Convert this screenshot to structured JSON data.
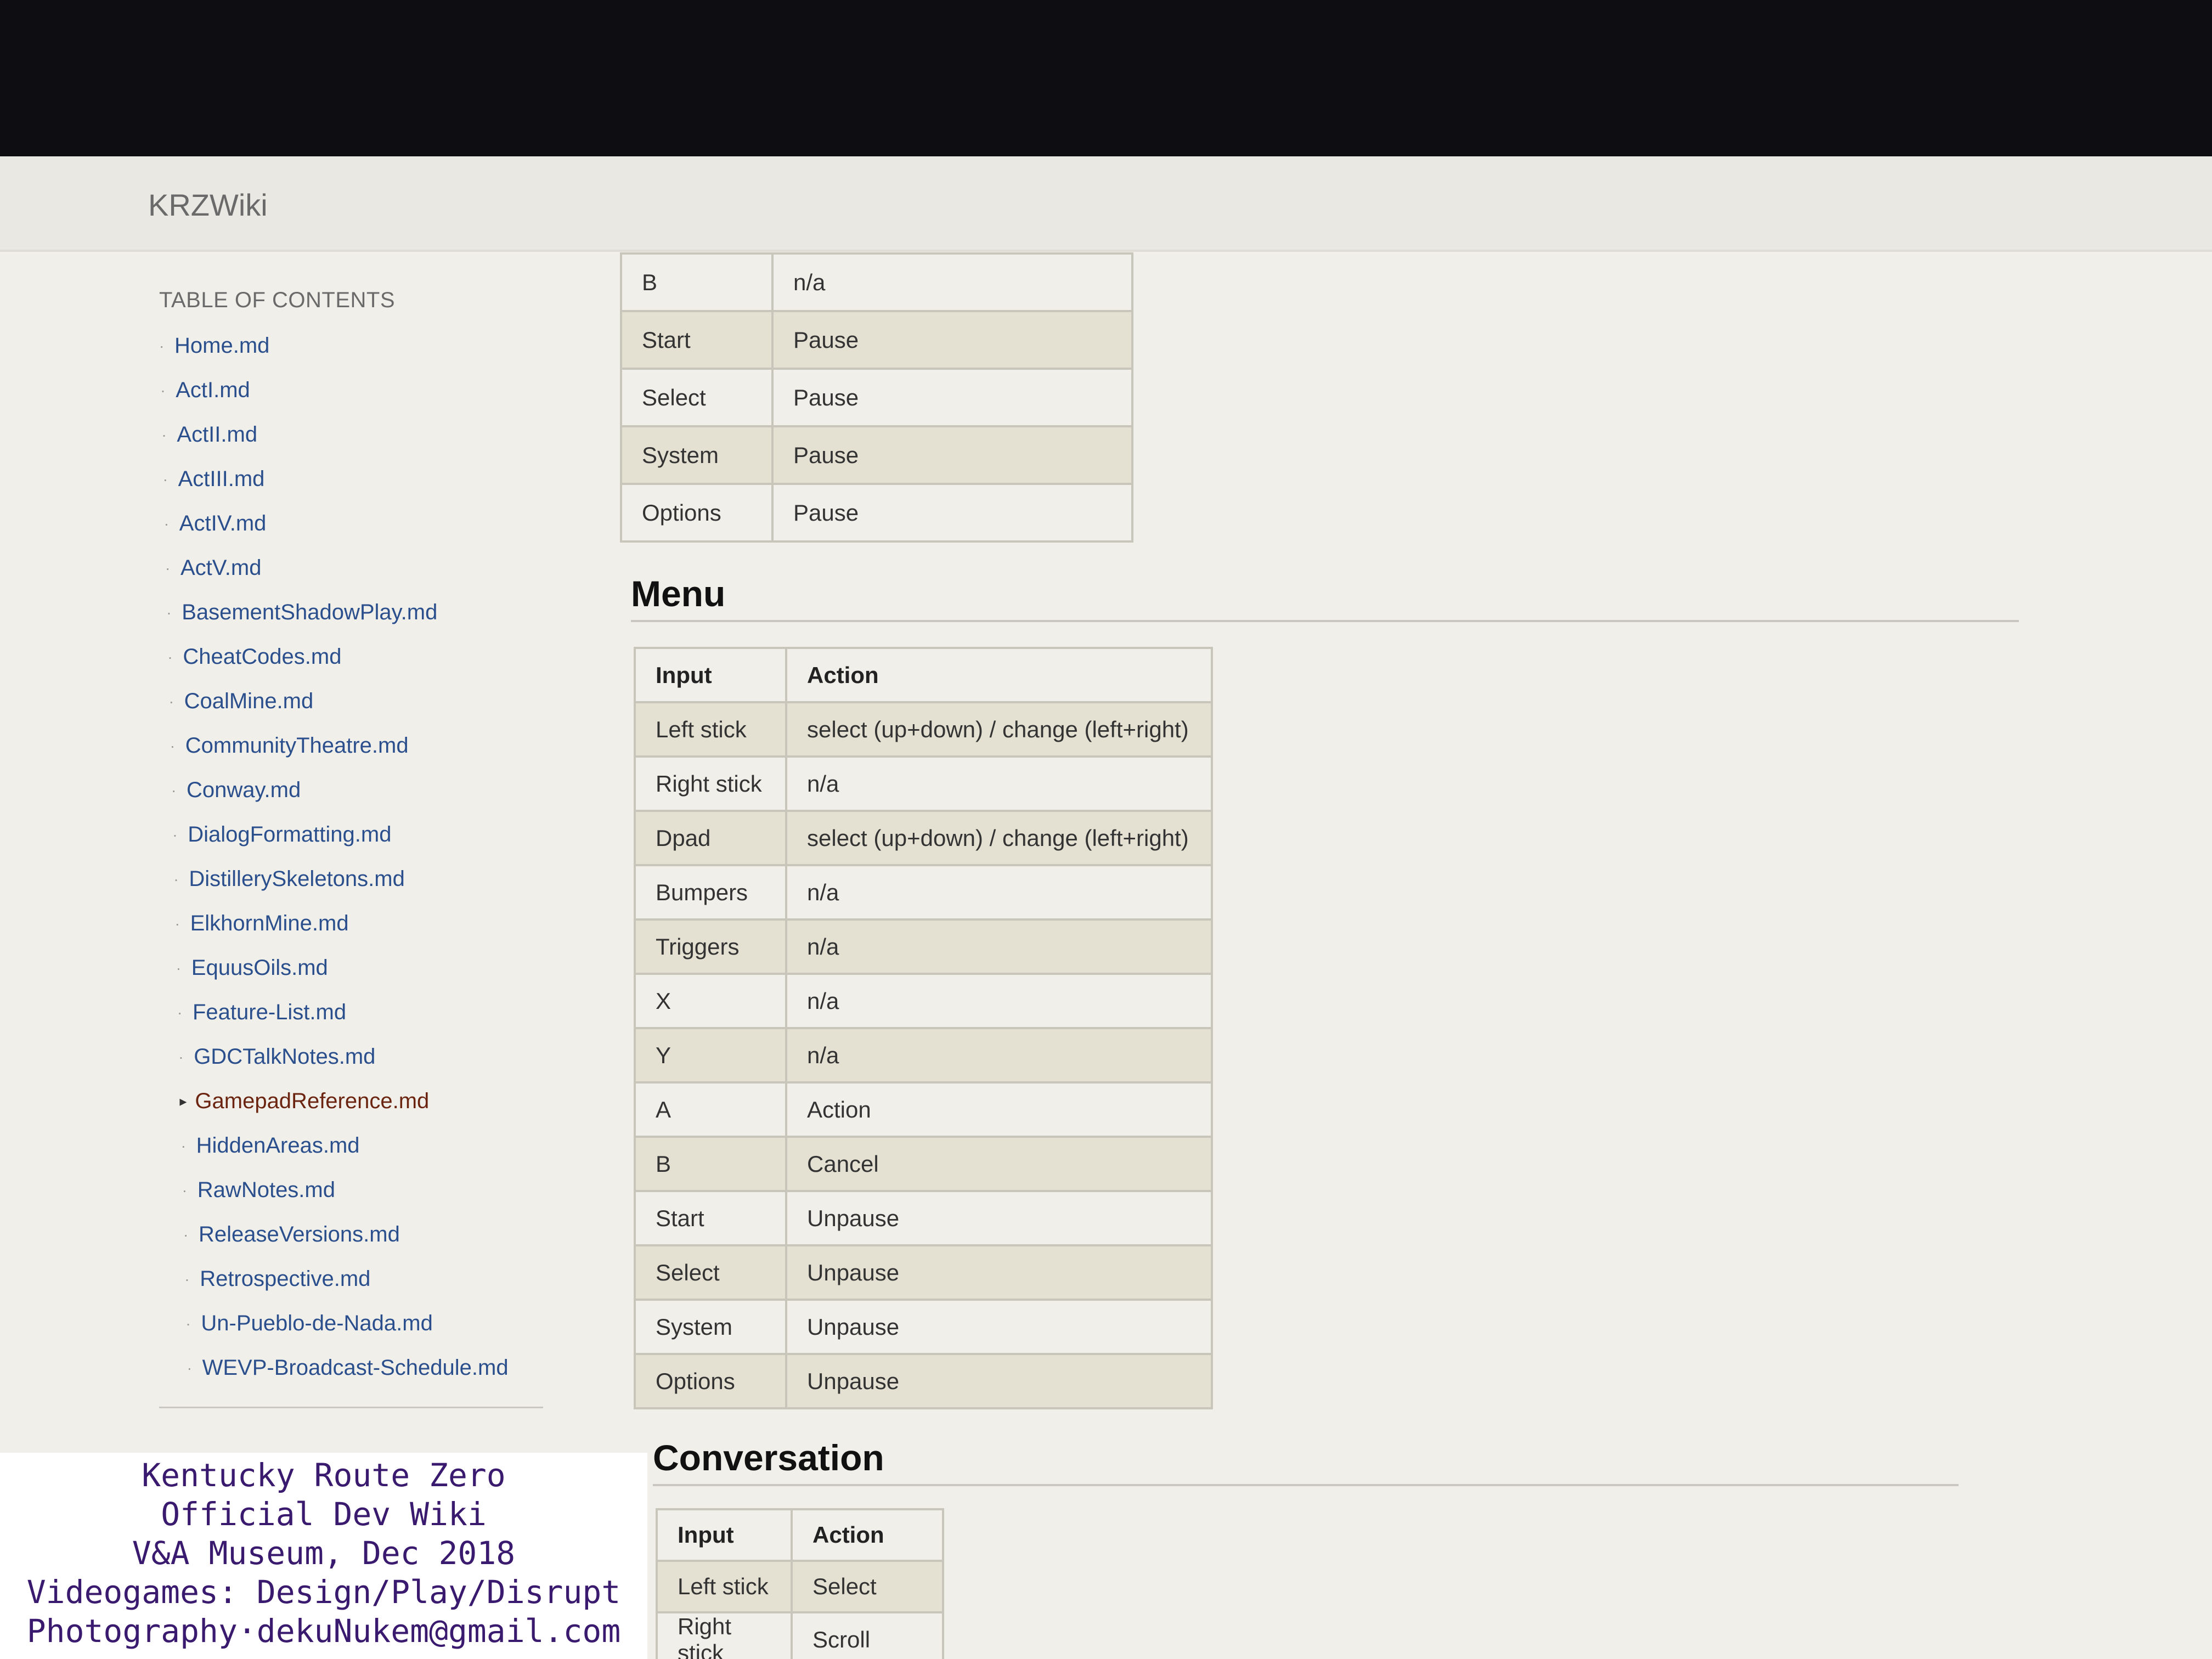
{
  "app": {
    "brand": "KRZWiki"
  },
  "sidebar": {
    "title": "TABLE OF CONTENTS",
    "items": [
      {
        "label": "Home.md"
      },
      {
        "label": "ActI.md"
      },
      {
        "label": "ActII.md"
      },
      {
        "label": "ActIII.md"
      },
      {
        "label": "ActIV.md"
      },
      {
        "label": "ActV.md"
      },
      {
        "label": "BasementShadowPlay.md"
      },
      {
        "label": "CheatCodes.md"
      },
      {
        "label": "CoalMine.md"
      },
      {
        "label": "CommunityTheatre.md"
      },
      {
        "label": "Conway.md"
      },
      {
        "label": "DialogFormatting.md"
      },
      {
        "label": "DistillerySkeletons.md"
      },
      {
        "label": "ElkhornMine.md"
      },
      {
        "label": "EquusOils.md"
      },
      {
        "label": "Feature-List.md"
      },
      {
        "label": "GDCTalkNotes.md"
      },
      {
        "label": "GamepadReference.md",
        "active": true
      },
      {
        "label": "HiddenAreas.md"
      },
      {
        "label": "RawNotes.md"
      },
      {
        "label": "ReleaseVersions.md"
      },
      {
        "label": "Retrospective.md"
      },
      {
        "label": "Un-Pueblo-de-Nada.md"
      },
      {
        "label": "WEVP-Broadcast-Schedule.md"
      }
    ]
  },
  "tables": {
    "top": {
      "rows": [
        [
          "B",
          "n/a"
        ],
        [
          "Start",
          "Pause"
        ],
        [
          "Select",
          "Pause"
        ],
        [
          "System",
          "Pause"
        ],
        [
          "Options",
          "Pause"
        ]
      ]
    },
    "menu": {
      "heading": "Menu",
      "header": [
        "Input",
        "Action"
      ],
      "rows": [
        [
          "Left stick",
          "select (up+down) / change (left+right)"
        ],
        [
          "Right stick",
          "n/a"
        ],
        [
          "Dpad",
          "select (up+down) / change (left+right)"
        ],
        [
          "Bumpers",
          "n/a"
        ],
        [
          "Triggers",
          "n/a"
        ],
        [
          "X",
          "n/a"
        ],
        [
          "Y",
          "n/a"
        ],
        [
          "A",
          "Action"
        ],
        [
          "B",
          "Cancel"
        ],
        [
          "Start",
          "Unpause"
        ],
        [
          "Select",
          "Unpause"
        ],
        [
          "System",
          "Unpause"
        ],
        [
          "Options",
          "Unpause"
        ]
      ]
    },
    "conversation": {
      "heading": "Conversation",
      "header": [
        "Input",
        "Action"
      ],
      "rows": [
        [
          "Left stick",
          "Select"
        ],
        [
          "Right stick",
          "Scroll"
        ]
      ]
    }
  },
  "caption": {
    "lines": [
      "Kentucky Route Zero",
      "Official Dev Wiki",
      "V&A Museum, Dec 2018",
      "Videogames: Design/Play/Disrupt",
      "Photography·dekuNukem@gmail.com"
    ]
  }
}
